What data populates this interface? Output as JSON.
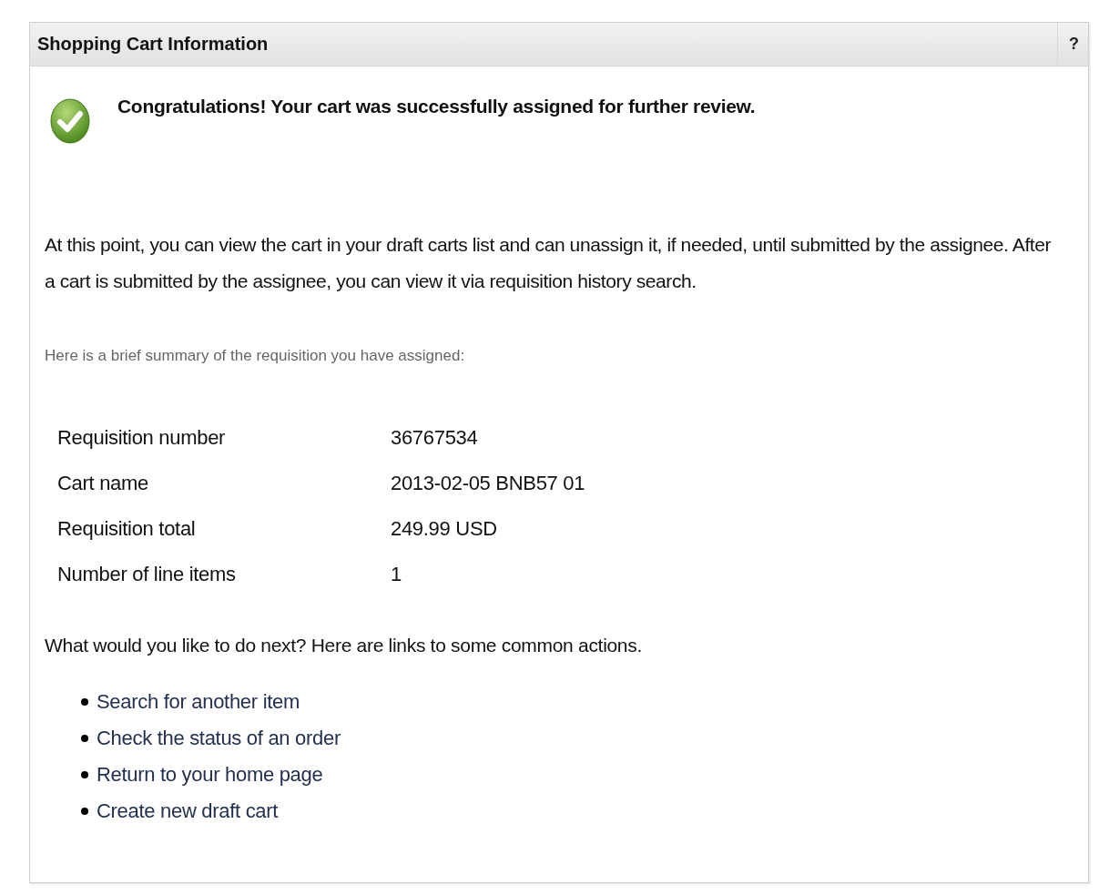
{
  "panel": {
    "title": "Shopping Cart Information",
    "help": "?"
  },
  "message": "Congratulations! Your cart was successfully assigned for further review.",
  "explanation": "At this point, you can view the cart in your draft carts list and can unassign it, if needed, until submitted by the assignee. After a cart is submitted by the assignee, you can view it via requisition history search.",
  "summary_intro": "Here is a brief summary of the requisition you have assigned:",
  "summary": [
    {
      "label": "Requisition number",
      "value": "36767534"
    },
    {
      "label": "Cart name",
      "value": "2013-02-05 BNB57 01"
    },
    {
      "label": "Requisition total",
      "value": "249.99 USD"
    },
    {
      "label": "Number of line items",
      "value": "1"
    }
  ],
  "next_prompt": "What would you like to do next? Here are links to some common actions.",
  "links": [
    "Search for another item",
    "Check the status of an order",
    "Return to your home page",
    "Create new draft cart"
  ]
}
